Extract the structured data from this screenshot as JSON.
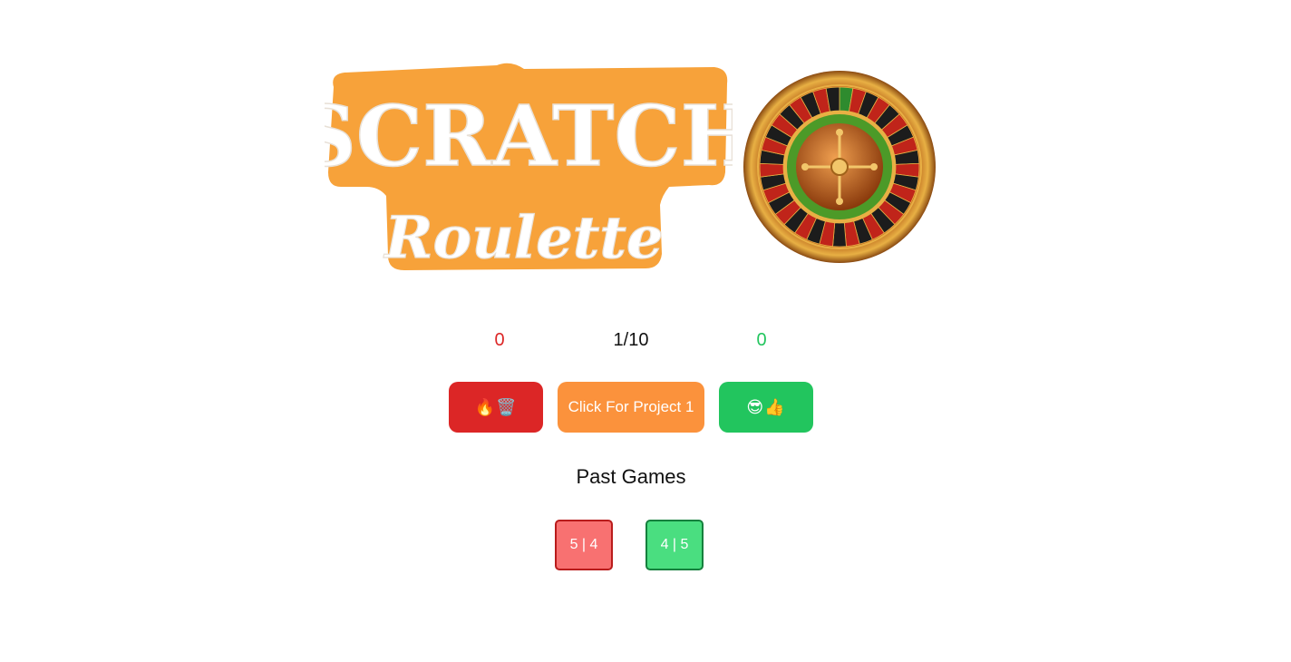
{
  "header": {
    "logo_line1": "SCRATCH",
    "logo_line2": "Roulette",
    "logo_color": "#f7a23a",
    "wheel_icon": "roulette-wheel-icon"
  },
  "scores": {
    "bad_count": "0",
    "progress": "1/10",
    "good_count": "0",
    "bad_color": "#dc2626",
    "good_color": "#22c55e"
  },
  "actions": {
    "bad_button_label": "🔥🗑️",
    "main_button_label": "Click For Project 1",
    "good_button_label": "😎👍",
    "main_color": "#fb923c"
  },
  "past_games": {
    "title": "Past Games",
    "games": [
      {
        "label": "5 | 4",
        "result": "loss",
        "color": "#f87171"
      },
      {
        "label": "4 | 5",
        "result": "win",
        "color": "#4ade80"
      }
    ]
  }
}
